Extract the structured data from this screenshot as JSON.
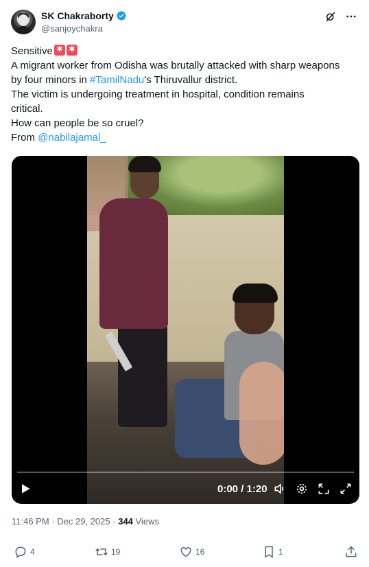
{
  "author": {
    "display_name": "SK Chakraborty",
    "handle": "@sanjoychakra",
    "verified": true,
    "avatar_icon": "avatar-icon"
  },
  "header_actions": [
    "grok-icon",
    "more-icon"
  ],
  "tweet": {
    "line1_text": "Sensitive",
    "line1_emojis": [
      "police-light-emoji",
      "police-light-emoji"
    ],
    "line2": "A migrant worker from Odisha was brutally attacked with sharp weapons",
    "line3_pre": "by four minors in ",
    "line3_hashtag": "#TamilNadu",
    "line3_post": "'s Thiruvallur district.",
    "line4": "The victim is undergoing treatment in hospital, condition remains",
    "line5": "critical.",
    "line6": "How can people be so cruel?",
    "line7_pre": "From ",
    "line7_mention": "@nabilajamal_"
  },
  "video": {
    "time": "0:00 / 1:20",
    "progress": 0,
    "controls": [
      "play-icon",
      "volume-icon",
      "settings-icon",
      "pip-icon",
      "fullscreen-icon"
    ]
  },
  "meta": {
    "time": "11:46 PM",
    "separator": "·",
    "date": "Dec 29, 2025",
    "views_count": "344",
    "views_label": "Views"
  },
  "actions": {
    "replies": "4",
    "reposts": "19",
    "likes": "16",
    "bookmarks": "1"
  },
  "colors": {
    "link": "#1d9bf0",
    "secondary_text": "#536471",
    "primary_text": "#0f1419"
  }
}
